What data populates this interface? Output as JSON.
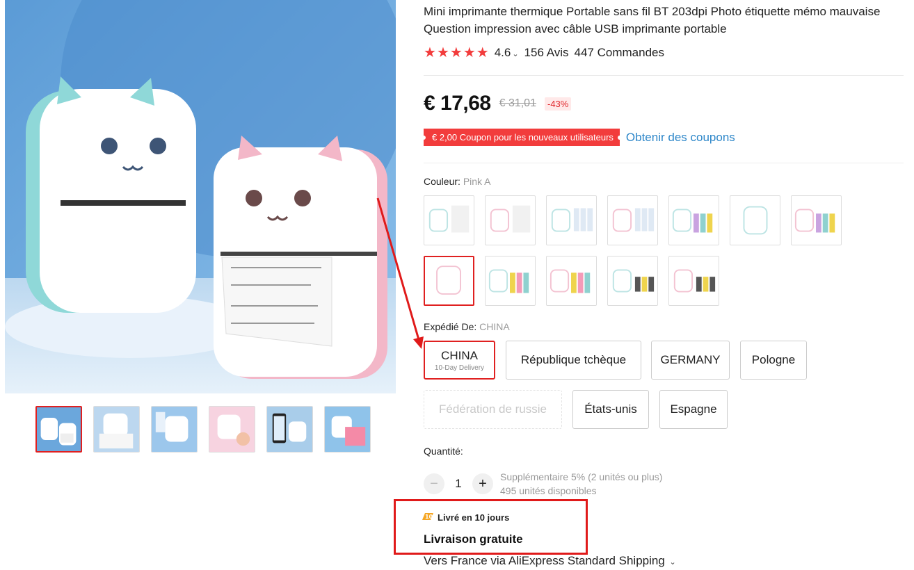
{
  "product": {
    "title": "Mini imprimante thermique Portable sans fil BT 203dpi Photo étiquette mémo mauvaise Question impression avec câble USB imprimante portable",
    "rating": "4.6",
    "reviews": "156 Avis",
    "orders": "447 Commandes"
  },
  "price": {
    "current": "€ 17,68",
    "original": "€ 31,01",
    "discount": "-43%"
  },
  "coupon": {
    "badge": "€ 2,00 Coupon pour les nouveaux utilisateurs",
    "link": "Obtenir des coupons"
  },
  "color": {
    "label": "Couleur:",
    "selected": "Pink A"
  },
  "ship_from": {
    "label": "Expédié De:",
    "selected": "CHINA",
    "options": [
      {
        "label": "CHINA",
        "sub": "10-Day Delivery"
      },
      {
        "label": "République tchèque"
      },
      {
        "label": "GERMANY"
      },
      {
        "label": "Pologne"
      },
      {
        "label": "Fédération de russie"
      },
      {
        "label": "États-unis"
      },
      {
        "label": "Espagne"
      }
    ]
  },
  "quantity": {
    "label": "Quantité:",
    "value": "1",
    "minus": "−",
    "plus": "+",
    "bulk_note": "Supplémentaire 5% (2 unités ou plus)",
    "available": "495 unités disponibles"
  },
  "delivery": {
    "days": "Livré en 10 jours",
    "free": "Livraison gratuite",
    "via": "Vers France via AliExpress Standard Shipping"
  },
  "colors": {
    "accent_red": "#f23c3c",
    "link_blue": "#2e87c9",
    "annotation_red": "#e01a1a"
  }
}
